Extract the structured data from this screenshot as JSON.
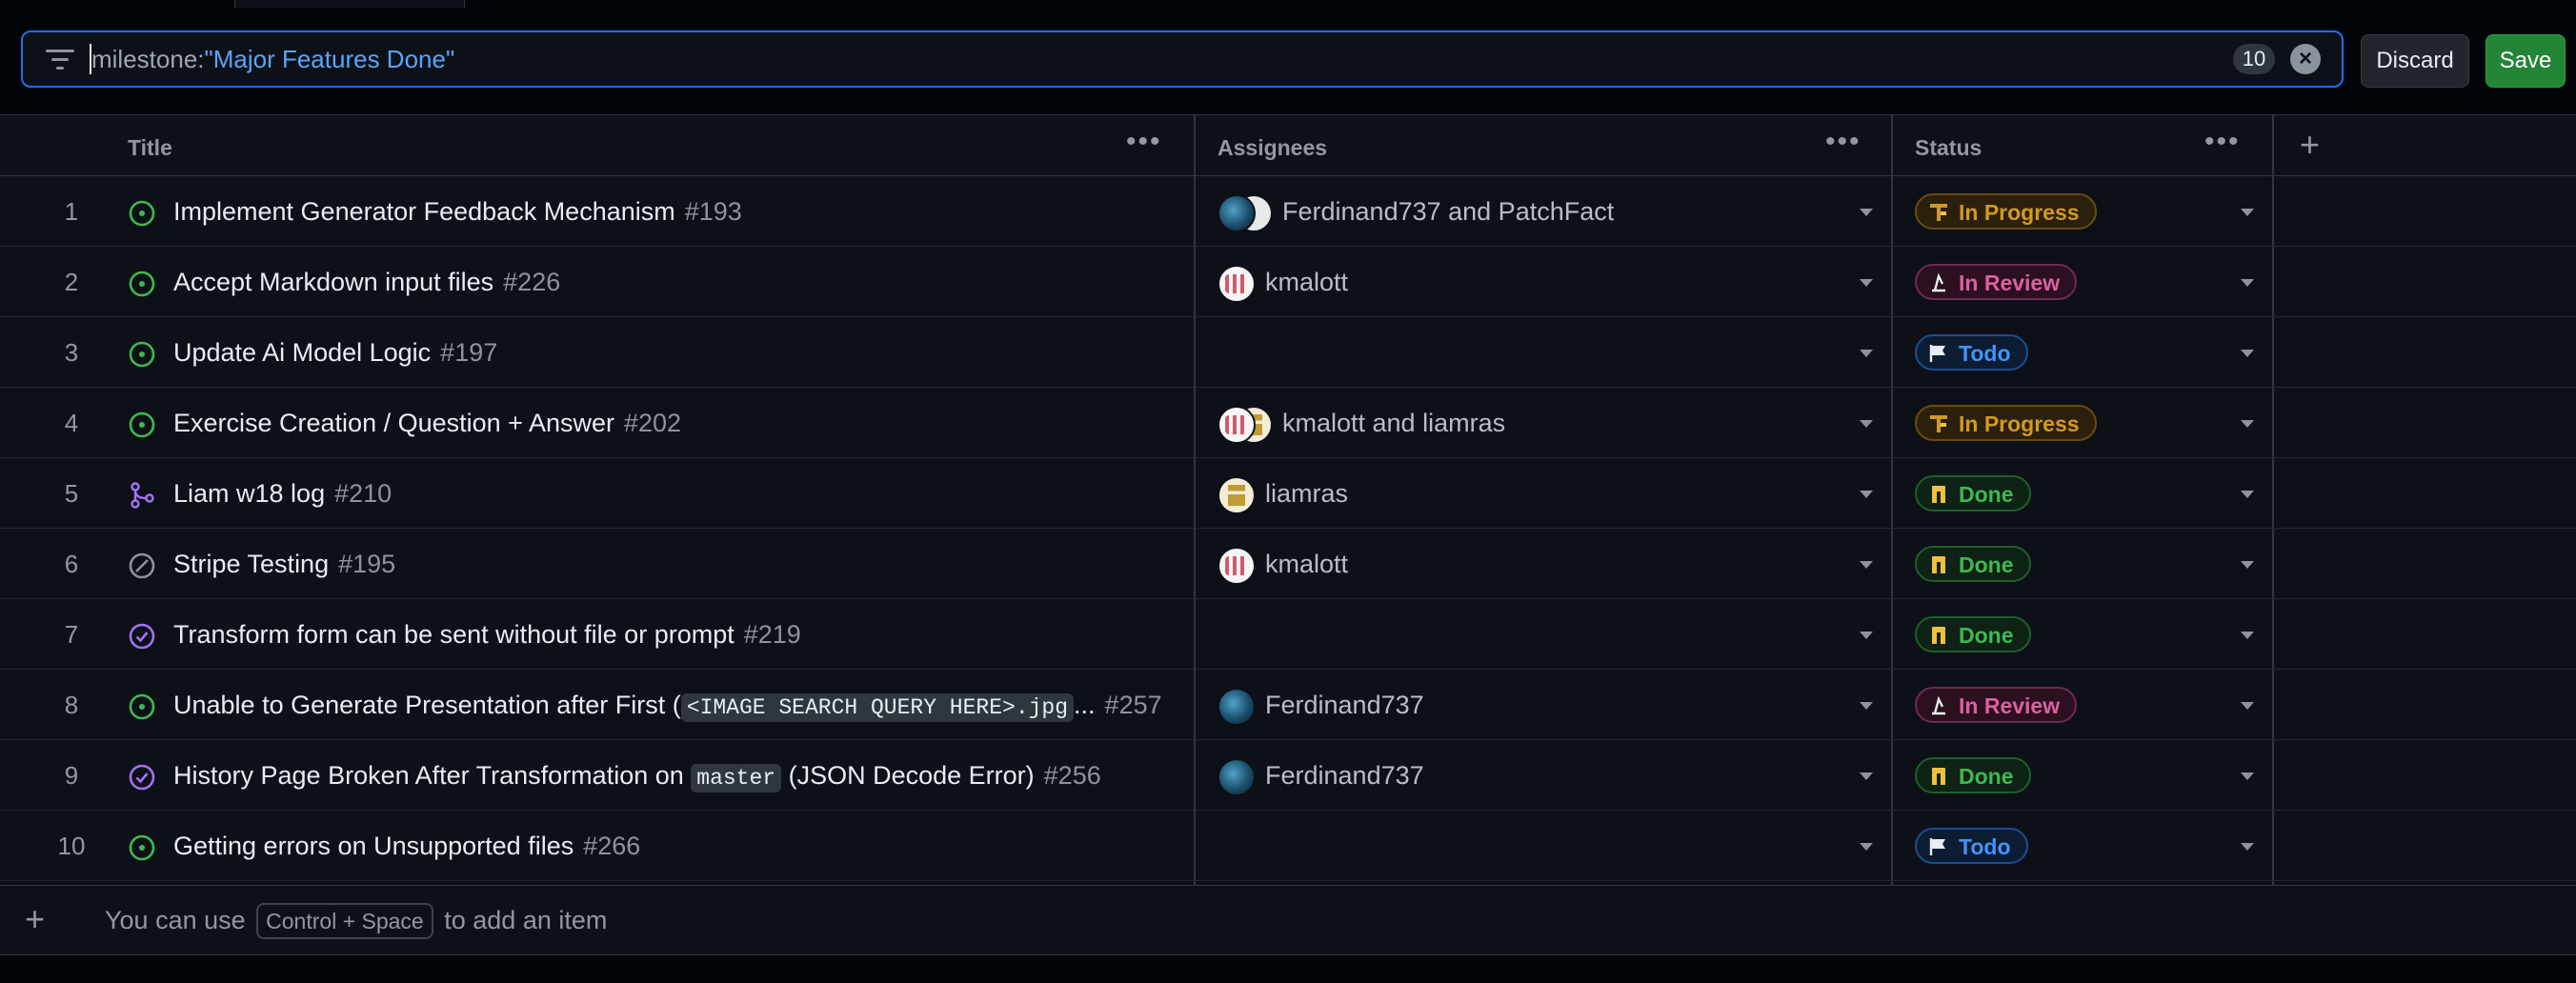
{
  "filter": {
    "key": "milestone:",
    "value": "\"Major Features Done\"",
    "count": "10",
    "discard_label": "Discard",
    "save_label": "Save"
  },
  "columns": {
    "title": "Title",
    "assignees": "Assignees",
    "status": "Status",
    "menu": "•••",
    "add": "+"
  },
  "rows": [
    {
      "n": "1",
      "state": "open-issue",
      "title": "Implement Generator Feedback Mechanism",
      "number": "#193",
      "assignees": "Ferdinand737 and PatchFact",
      "avatars": [
        "Ferdinand737",
        "PatchFact"
      ],
      "status": "In Progress"
    },
    {
      "n": "2",
      "state": "open-issue",
      "title": "Accept Markdown input files",
      "number": "#226",
      "assignees": "kmalott",
      "avatars": [
        "kmalott"
      ],
      "status": "In Review"
    },
    {
      "n": "3",
      "state": "open-issue",
      "title": "Update Ai Model Logic",
      "number": "#197",
      "assignees": "",
      "avatars": [],
      "status": "Todo"
    },
    {
      "n": "4",
      "state": "open-issue",
      "title": "Exercise Creation / Question + Answer",
      "number": "#202",
      "assignees": "kmalott and liamras",
      "avatars": [
        "kmalott",
        "liamras"
      ],
      "status": "In Progress"
    },
    {
      "n": "5",
      "state": "merged-pr",
      "title": "Liam w18 log",
      "number": "#210",
      "assignees": "liamras",
      "avatars": [
        "liamras"
      ],
      "status": "Done"
    },
    {
      "n": "6",
      "state": "not-planned",
      "title": "Stripe Testing",
      "number": "#195",
      "assignees": "kmalott",
      "avatars": [
        "kmalott"
      ],
      "status": "Done"
    },
    {
      "n": "7",
      "state": "closed-issue",
      "title": "Transform form can be sent without file or prompt",
      "number": "#219",
      "assignees": "",
      "avatars": [],
      "status": "Done"
    },
    {
      "n": "8",
      "state": "open-issue",
      "title_pre": "Unable to Generate Presentation after First (",
      "title_code": "<IMAGE SEARCH QUERY HERE>.jpg",
      "title_post": "...",
      "number": "#257",
      "assignees": "Ferdinand737",
      "avatars": [
        "Ferdinand737"
      ],
      "status": "In Review"
    },
    {
      "n": "9",
      "state": "closed-issue",
      "title_pre": "History Page Broken After Transformation on ",
      "title_code": "master",
      "title_post": " (JSON Decode Error)",
      "number": "#256",
      "assignees": "Ferdinand737",
      "avatars": [
        "Ferdinand737"
      ],
      "status": "Done"
    },
    {
      "n": "10",
      "state": "open-issue",
      "title": "Getting errors on Unsupported files",
      "number": "#266",
      "assignees": "",
      "avatars": [],
      "status": "Todo"
    }
  ],
  "footer": {
    "add_icon": "+",
    "text_before": "You can use",
    "shortcut": "Control + Space",
    "text_after": "to add an item"
  },
  "colors": {
    "accent": "#1f6feb",
    "open": "#3fb950",
    "merged": "#a371f7",
    "not_planned": "#8b949e",
    "in_progress": "#d29922",
    "in_review": "#db61a2",
    "todo": "#4493f8",
    "done": "#3fb950"
  }
}
